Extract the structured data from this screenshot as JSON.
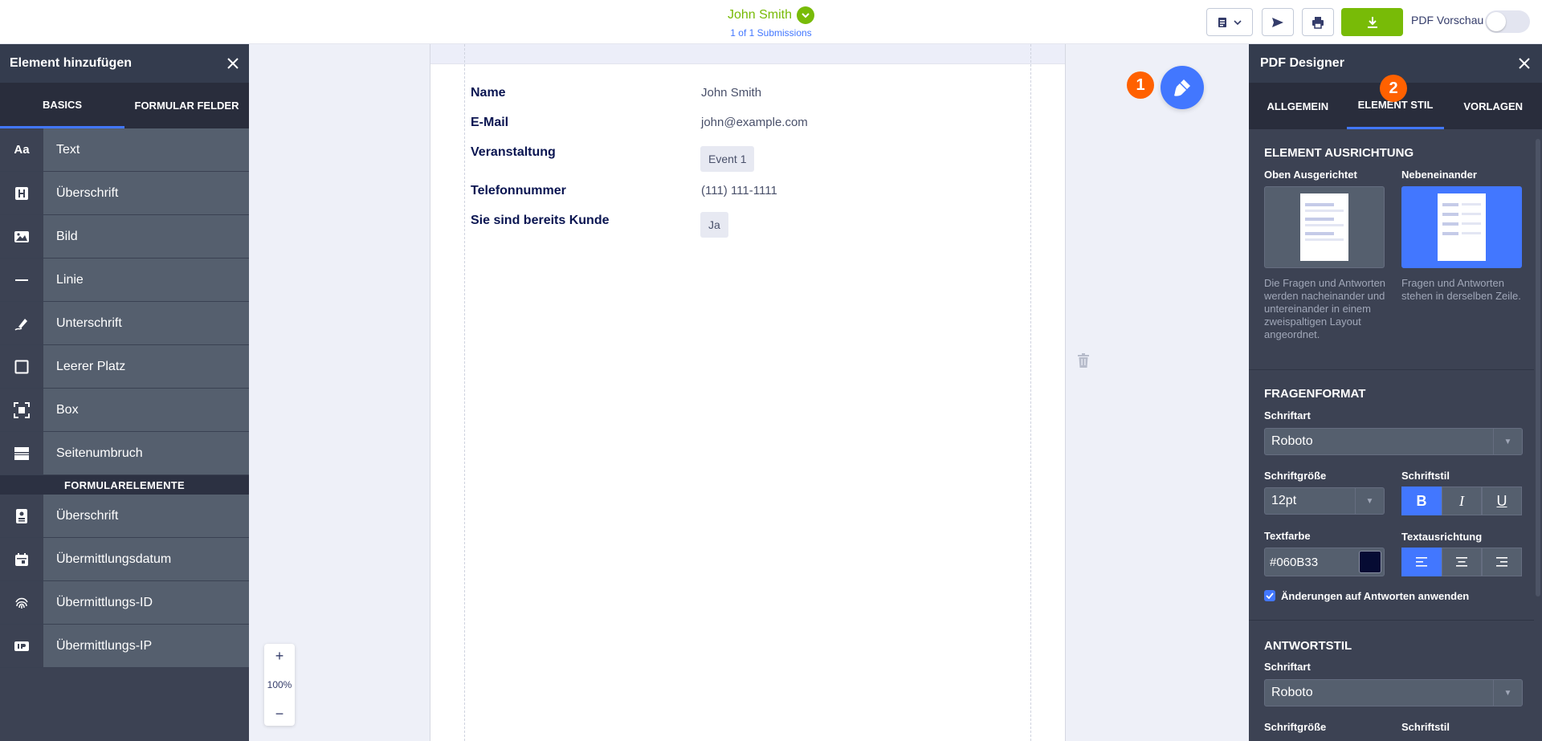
{
  "topbar": {
    "submitter_name": "John Smith",
    "submission_count": "1 of 1 Submissions",
    "pdf_preview_label": "PDF Vorschau"
  },
  "left_panel": {
    "title": "Element hinzufügen",
    "tabs": [
      "BASICS",
      "FORMULAR FELDER"
    ],
    "basic_items": [
      {
        "label": "Text",
        "icon": "text-icon"
      },
      {
        "label": "Überschrift",
        "icon": "heading-icon"
      },
      {
        "label": "Bild",
        "icon": "image-icon"
      },
      {
        "label": "Linie",
        "icon": "line-icon"
      },
      {
        "label": "Unterschrift",
        "icon": "signature-icon"
      },
      {
        "label": "Leerer Platz",
        "icon": "empty-space-icon"
      },
      {
        "label": "Box",
        "icon": "box-icon"
      },
      {
        "label": "Seitenumbruch",
        "icon": "page-break-icon"
      }
    ],
    "section_label": "FORMULARELEMENTE",
    "form_items": [
      {
        "label": "Überschrift",
        "icon": "form-heading-icon"
      },
      {
        "label": "Übermittlungsdatum",
        "icon": "calendar-icon"
      },
      {
        "label": "Übermittlungs-ID",
        "icon": "fingerprint-icon"
      },
      {
        "label": "Übermittlungs-IP",
        "icon": "ip-icon"
      }
    ]
  },
  "document": {
    "rows": [
      {
        "question": "Name",
        "answer": "John Smith"
      },
      {
        "question": "E-Mail",
        "answer": "john@example.com"
      },
      {
        "question": "Veranstaltung",
        "answer": "Event 1"
      },
      {
        "question": "Telefonnummer",
        "answer": "(111) 111-1111"
      },
      {
        "question": "Sie sind bereits Kunde",
        "answer": "Ja"
      }
    ],
    "step_marker_1": "1",
    "zoom_level": "100%"
  },
  "right_panel": {
    "title": "PDF Designer",
    "tabs": [
      "ALLGEMEIN",
      "ELEMENT STIL",
      "VORLAGEN"
    ],
    "step_marker_2": "2",
    "alignment": {
      "title": "ELEMENT AUSRICHTUNG",
      "option_top_label": "Oben Ausgerichtet",
      "option_top_desc": "Die Fragen und Antworten werden nacheinander und untereinander in einem zweispaltigen Layout angeordnet.",
      "option_side_label": "Nebeneinander",
      "option_side_desc": "Fragen und Antworten stehen in derselben Zeile."
    },
    "question_format": {
      "title": "FRAGENFORMAT",
      "font_label": "Schriftart",
      "font_value": "Roboto",
      "size_label": "Schriftgröße",
      "size_value": "12pt",
      "style_label": "Schriftstil",
      "color_label": "Textfarbe",
      "color_value": "#060B33",
      "align_label": "Textausrichtung",
      "apply_label": "Änderungen auf Antworten anwenden"
    },
    "answer_style": {
      "title": "ANTWORTSTIL",
      "font_label": "Schriftart",
      "font_value": "Roboto",
      "size_label": "Schriftgröße",
      "style_label": "Schriftstil"
    }
  }
}
